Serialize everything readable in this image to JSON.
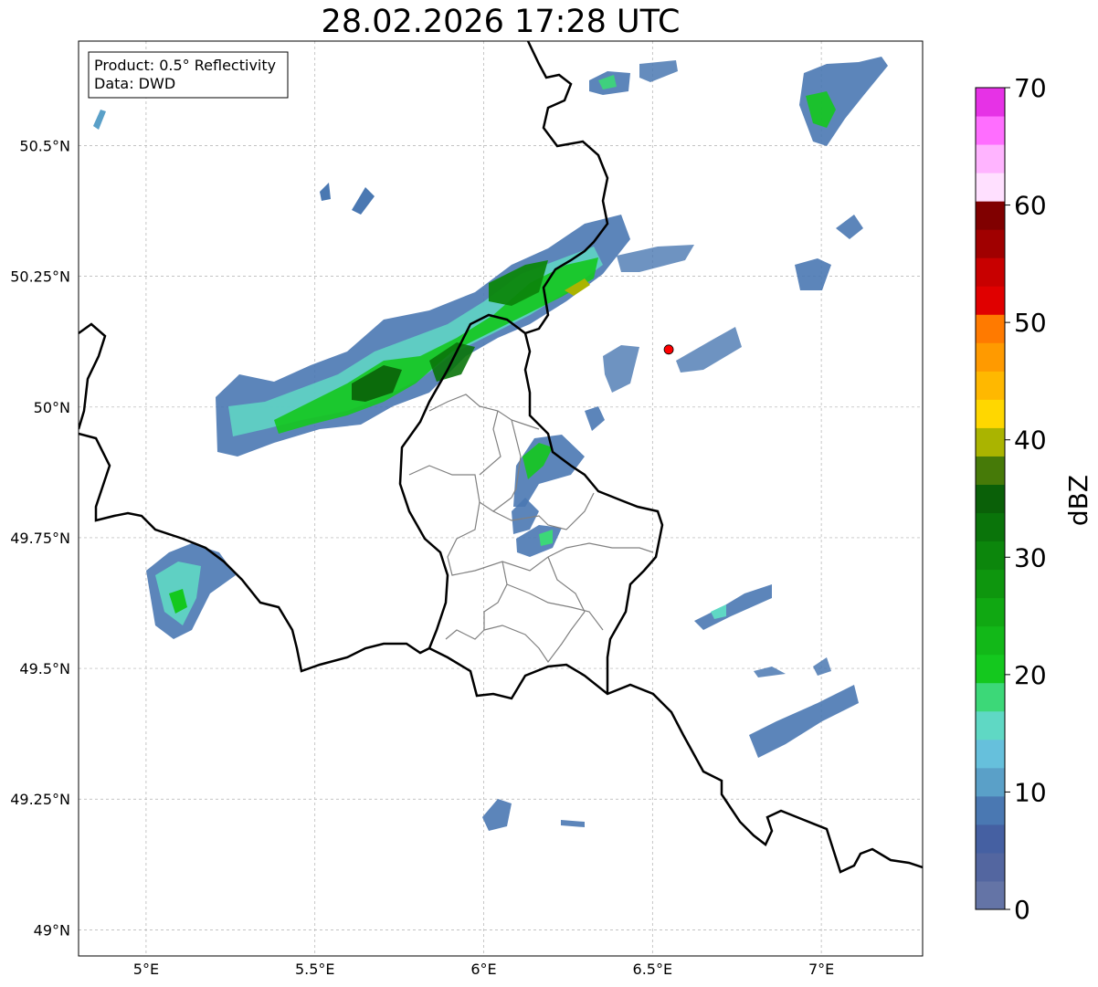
{
  "title": "28.02.2026 17:28 UTC",
  "info_box": {
    "product": "Product: 0.5° Reflectivity",
    "data": "Data: DWD"
  },
  "map": {
    "lon_range": [
      4.8,
      7.3
    ],
    "lat_range": [
      48.95,
      50.7
    ],
    "lon_ticks": [
      {
        "value": 5.0,
        "label": "5°E"
      },
      {
        "value": 5.5,
        "label": "5.5°E"
      },
      {
        "value": 6.0,
        "label": "6°E"
      },
      {
        "value": 6.5,
        "label": "6.5°E"
      },
      {
        "value": 7.0,
        "label": "7°E"
      }
    ],
    "lat_ticks": [
      {
        "value": 49.0,
        "label": "49°N"
      },
      {
        "value": 49.25,
        "label": "49.25°N"
      },
      {
        "value": 49.5,
        "label": "49.5°N"
      },
      {
        "value": 49.75,
        "label": "49.75°N"
      },
      {
        "value": 50.0,
        "label": "50°N"
      },
      {
        "value": 50.25,
        "label": "50.25°N"
      },
      {
        "value": 50.5,
        "label": "50.5°N"
      }
    ],
    "radar_site": {
      "lon": 6.548,
      "lat": 50.11,
      "color": "#ff0000"
    },
    "gridlines": true
  },
  "colorbar": {
    "label": "dBZ",
    "min": 0,
    "max": 70,
    "ticks": [
      0,
      10,
      20,
      30,
      40,
      50,
      60,
      70
    ],
    "colors": [
      "#6474a6",
      "#5366a0",
      "#4560a2",
      "#4a78b2",
      "#5aa0c8",
      "#66c0dc",
      "#5fd8c4",
      "#3cd878",
      "#14c81e",
      "#12b818",
      "#10a812",
      "#0e960e",
      "#0c860c",
      "#0a740a",
      "#0a6008",
      "#467a08",
      "#aab400",
      "#ffd700",
      "#ffb800",
      "#ff9a00",
      "#ff7a00",
      "#e00000",
      "#c80000",
      "#a00000",
      "#800000",
      "#ffe0ff",
      "#ffb4ff",
      "#ff6eff",
      "#e632e6"
    ]
  }
}
